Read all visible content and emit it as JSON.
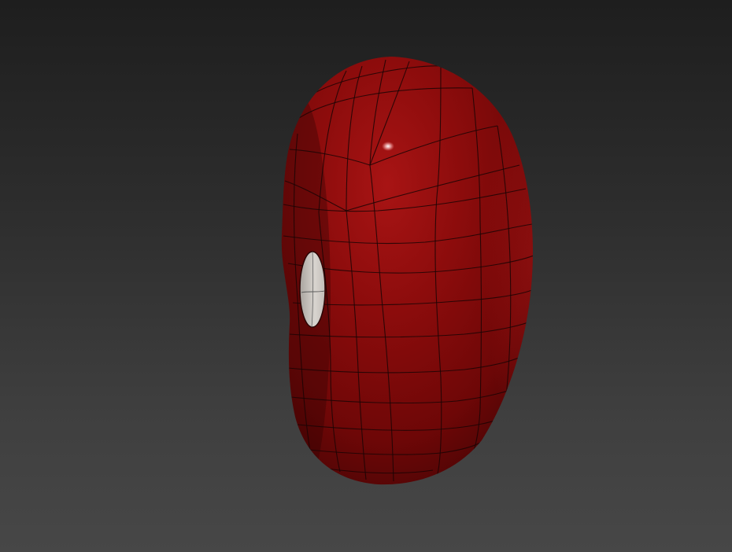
{
  "viewport": {
    "background_top": "#1e1e1e",
    "background_bottom": "#474747"
  },
  "model": {
    "object": "bean",
    "material_color": "#8a0b0b",
    "highlight_color": "#ffffff",
    "wireframe_color": "#1a0505",
    "hole_color": "#cfcbc6"
  }
}
